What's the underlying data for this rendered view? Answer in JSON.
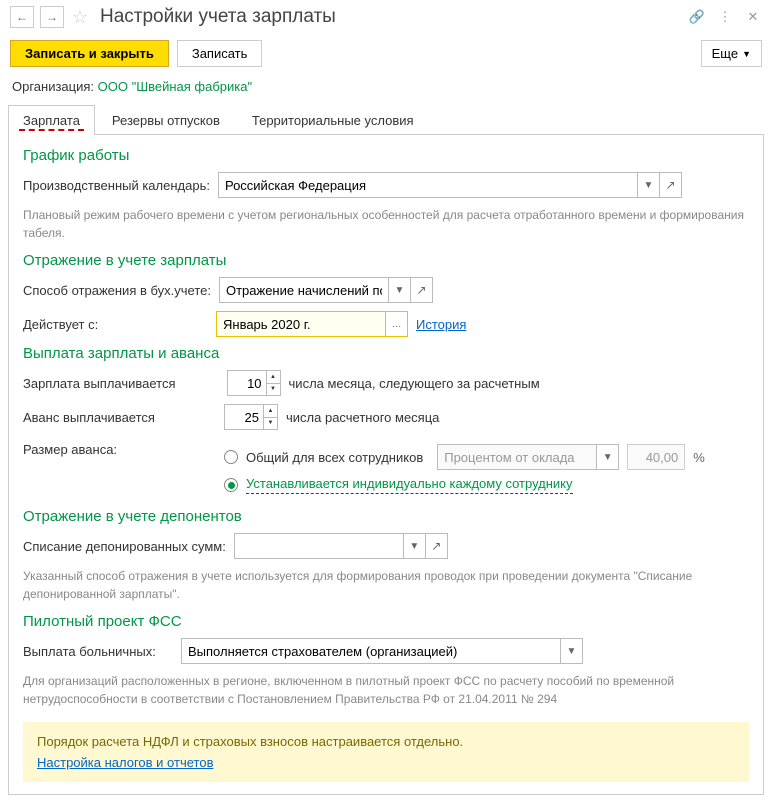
{
  "titlebar": {
    "title": "Настройки учета зарплаты"
  },
  "toolbar": {
    "save_close": "Записать и закрыть",
    "save": "Записать",
    "more": "Еще"
  },
  "org": {
    "label": "Организация: ",
    "value": "ООО \"Швейная фабрика\""
  },
  "tabs": {
    "salary": "Зарплата",
    "reserves": "Резервы отпусков",
    "territorial": "Территориальные условия"
  },
  "sections": {
    "schedule": {
      "title": "График работы",
      "calendar_label": "Производственный календарь:",
      "calendar_value": "Российская Федерация",
      "hint": "Плановый режим рабочего времени с учетом региональных особенностей для расчета отработанного времени и формирования табеля."
    },
    "accounting": {
      "title": "Отражение в учете зарплаты",
      "method_label": "Способ отражения в бух.учете:",
      "method_value": "Отражение начислений по",
      "effective_label": "Действует с:",
      "effective_value": "Январь 2020 г.",
      "history_link": "История"
    },
    "payment": {
      "title": "Выплата зарплаты и аванса",
      "salary_paid_label": "Зарплата выплачивается",
      "salary_day": "10",
      "salary_after": "числа месяца, следующего за расчетным",
      "advance_paid_label": "Аванс выплачивается",
      "advance_day": "25",
      "advance_after": "числа расчетного месяца",
      "advance_size_label": "Размер аванса:",
      "radio_common": "Общий для всех сотрудников",
      "radio_individual": "Устанавливается индивидуально каждому сотруднику",
      "percent_label": "Процентом от оклада",
      "percent_value": "40,00",
      "percent_sign": "%"
    },
    "deponents": {
      "title": "Отражение в учете депонентов",
      "writeoff_label": "Списание депонированных сумм:",
      "hint": "Указанный способ отражения в учете используется для формирования проводок при проведении документа \"Списание депонированной зарплаты\"."
    },
    "pilot": {
      "title": "Пилотный проект ФСС",
      "sick_label": "Выплата больничных:",
      "sick_value": "Выполняется страхователем (организацией)",
      "hint": "Для организаций расположенных в регионе, включенном в пилотный проект ФСС по расчету пособий по временной нетрудоспособности в соответствии с Постановлением Правительства РФ от 21.04.2011 № 294"
    },
    "notice": {
      "text": "Порядок расчета НДФЛ и страховых взносов настраивается отдельно.",
      "link": "Настройка налогов и отчетов"
    }
  }
}
